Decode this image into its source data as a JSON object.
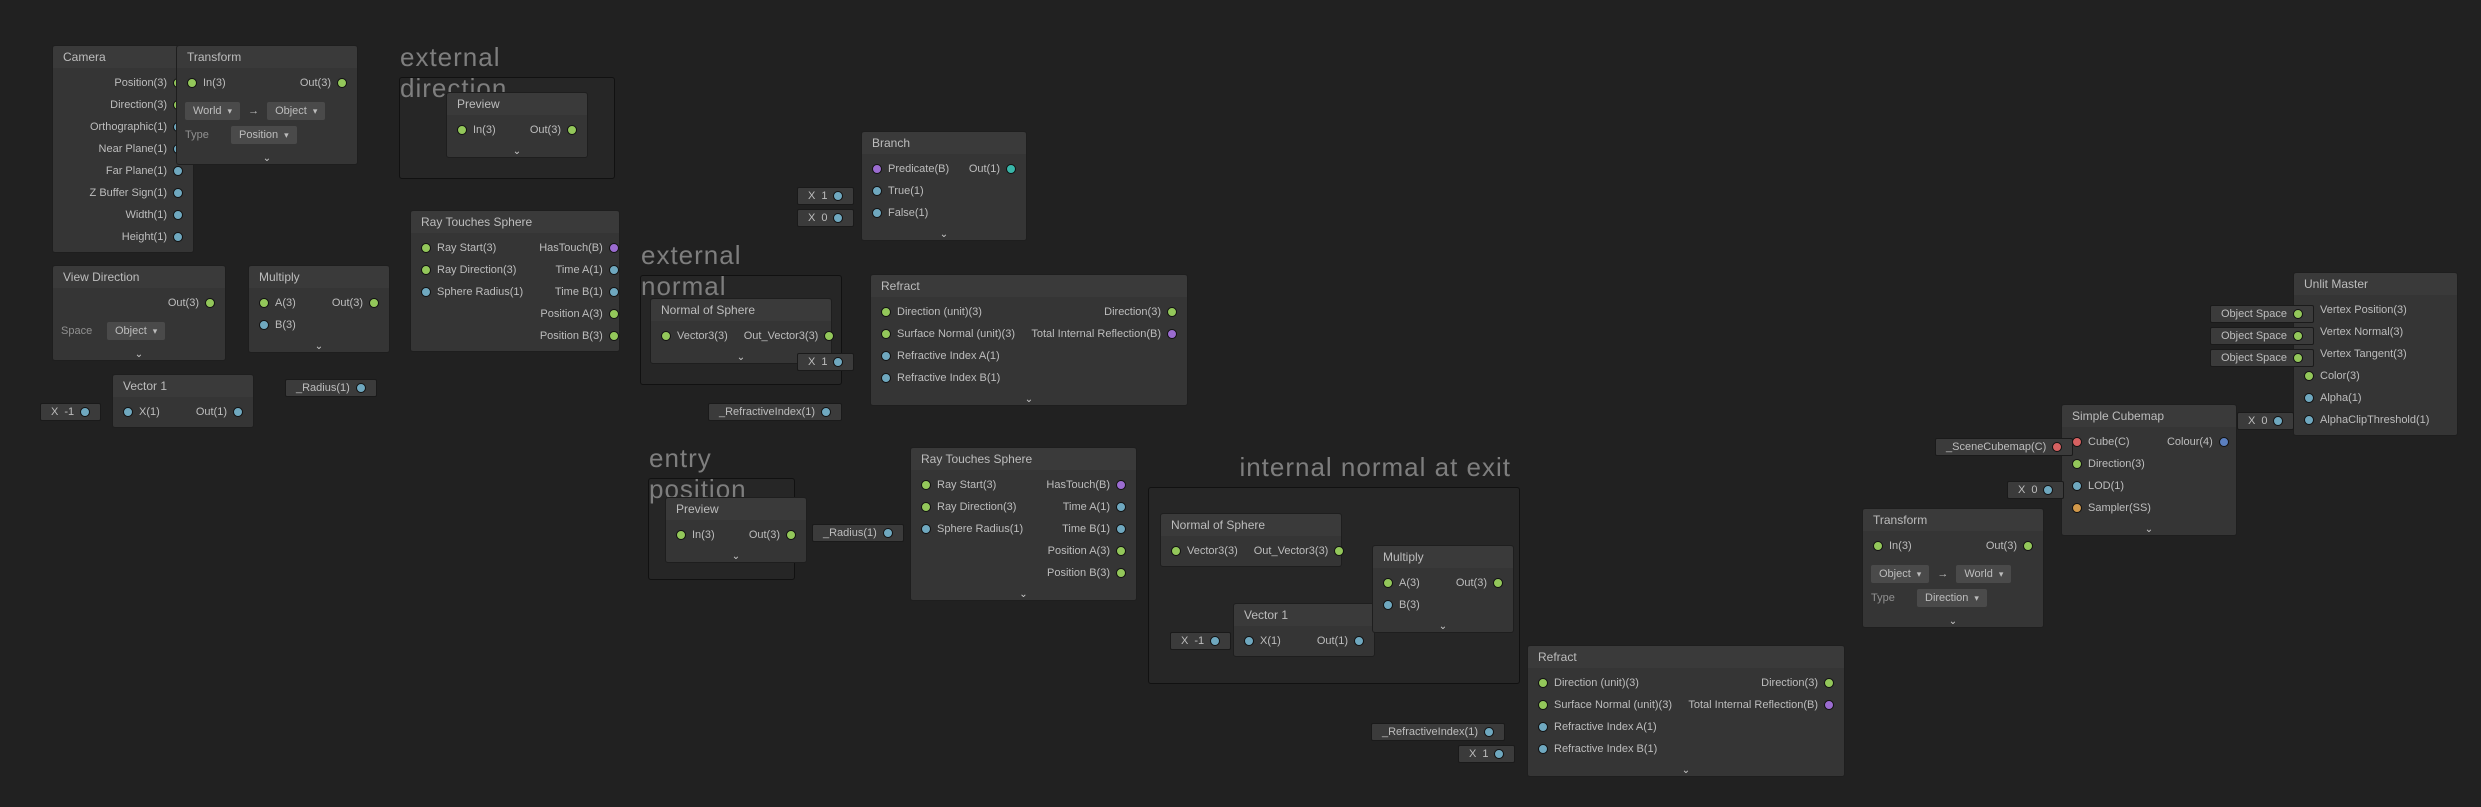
{
  "groups": {
    "ext_dir": "external direction",
    "ext_normal": "external normal",
    "entry_pos": "entry position",
    "int_normal": "internal normal at exit"
  },
  "camera": {
    "title": "Camera",
    "outs": [
      "Position(3)",
      "Direction(3)",
      "Orthographic(1)",
      "Near Plane(1)",
      "Far Plane(1)",
      "Z Buffer Sign(1)",
      "Width(1)",
      "Height(1)"
    ]
  },
  "transform": {
    "title": "Transform",
    "in": "In(3)",
    "out": "Out(3)",
    "from": "World",
    "to": "Object",
    "type_label": "Type",
    "type": "Position"
  },
  "transform2": {
    "from": "Object",
    "to": "World",
    "type": "Direction"
  },
  "viewdir": {
    "title": "View Direction",
    "out": "Out(3)",
    "space_label": "Space",
    "space": "Object"
  },
  "mult": {
    "title": "Multiply",
    "a": "A(3)",
    "b": "B(3)",
    "out": "Out(3)"
  },
  "vec1": {
    "title": "Vector 1",
    "x": "X(1)",
    "out": "Out(1)",
    "xval": "-1"
  },
  "props": {
    "radius": "_Radius(1)",
    "refr": "_RefractiveIndex(1)",
    "cubemap": "_SceneCubemap(C)"
  },
  "preview": {
    "title": "Preview",
    "in": "In(3)",
    "out": "Out(3)"
  },
  "rts": {
    "title": "Ray Touches Sphere",
    "ins": [
      "Ray Start(3)",
      "Ray Direction(3)",
      "Sphere Radius(1)"
    ],
    "outs": [
      "HasTouch(B)",
      "Time A(1)",
      "Time B(1)",
      "Position A(3)",
      "Position B(3)"
    ]
  },
  "nos": {
    "title": "Normal of Sphere",
    "in": "Vector3(3)",
    "out": "Out_Vector3(3)"
  },
  "branch": {
    "title": "Branch",
    "ins": [
      "Predicate(B)",
      "True(1)",
      "False(1)"
    ],
    "out": "Out(1)",
    "true_val": "1",
    "false_val": "0"
  },
  "refract": {
    "title": "Refract",
    "ins": [
      "Direction (unit)(3)",
      "Surface Normal (unit)(3)",
      "Refractive Index A(1)",
      "Refractive Index B(1)"
    ],
    "outs": [
      "Direction(3)",
      "Total Internal Reflection(B)"
    ],
    "ria": "1"
  },
  "refract2": {
    "rib": "1"
  },
  "cubemap": {
    "title": "Simple Cubemap",
    "ins": [
      "Cube(C)",
      "Direction(3)",
      "LOD(1)",
      "Sampler(SS)"
    ],
    "out": "Colour(4)",
    "lod": "0"
  },
  "master": {
    "title": "Unlit Master",
    "ins": [
      "Vertex Position(3)",
      "Vertex Normal(3)",
      "Vertex Tangent(3)",
      "Color(3)",
      "Alpha(1)",
      "AlphaClipThreshold(1)"
    ],
    "space": "Object Space",
    "clip": "0"
  }
}
